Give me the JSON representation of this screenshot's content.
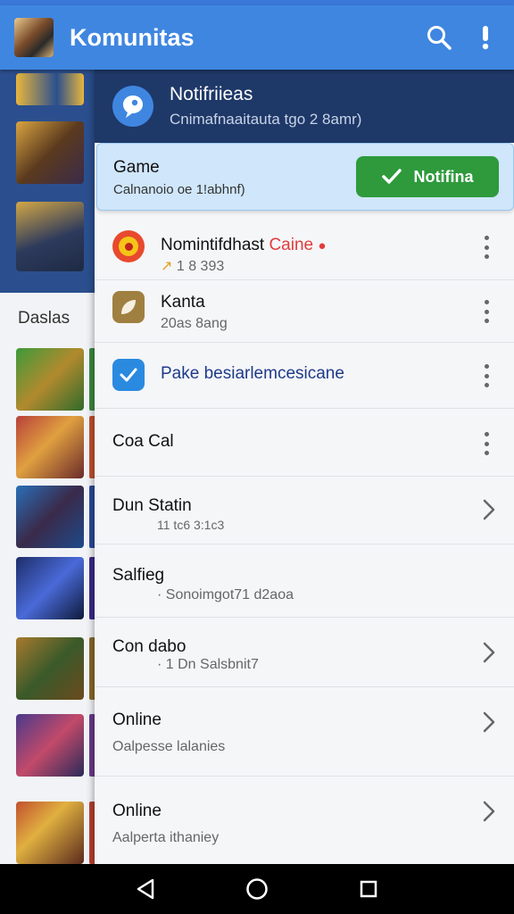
{
  "app_bar": {
    "title": "Komunitas"
  },
  "background_list": {
    "section_label": "Daslas"
  },
  "drawer": {
    "title": "Notifriieas",
    "subtitle": "Cnimafnaaitauta tgo 2 8amr)",
    "game_card": {
      "title": "Game",
      "subtitle": "Calnanoio oe 1!abhnf)",
      "button_label": "Notifina"
    },
    "items": [
      {
        "title": "Nomintifdhast",
        "title_extra": "Caine",
        "subtitle": "1 8 393"
      },
      {
        "title": "Kanta",
        "subtitle": "20as 8ang"
      },
      {
        "title": "Pake besiarlemcesicane"
      },
      {
        "title": "Coa Cal"
      },
      {
        "title": "Dun Statin",
        "subtitle": "11 tc6 3:1c3"
      },
      {
        "title": "Salfieg",
        "subtitle": "· Sonoimgot71 d2aoa"
      },
      {
        "title": "Con dabo",
        "subtitle": "· 1 Dn Salsbnit7"
      },
      {
        "title": "Online",
        "subtitle": "Oalpesse lalanies"
      },
      {
        "title": "Online",
        "subtitle": "Aalperta ithaniey"
      }
    ]
  },
  "colors": {
    "app_bar": "#3f86e0",
    "drawer_header": "#1e3868",
    "notify_button": "#2e9a3c",
    "card": "#cfe6fb"
  }
}
